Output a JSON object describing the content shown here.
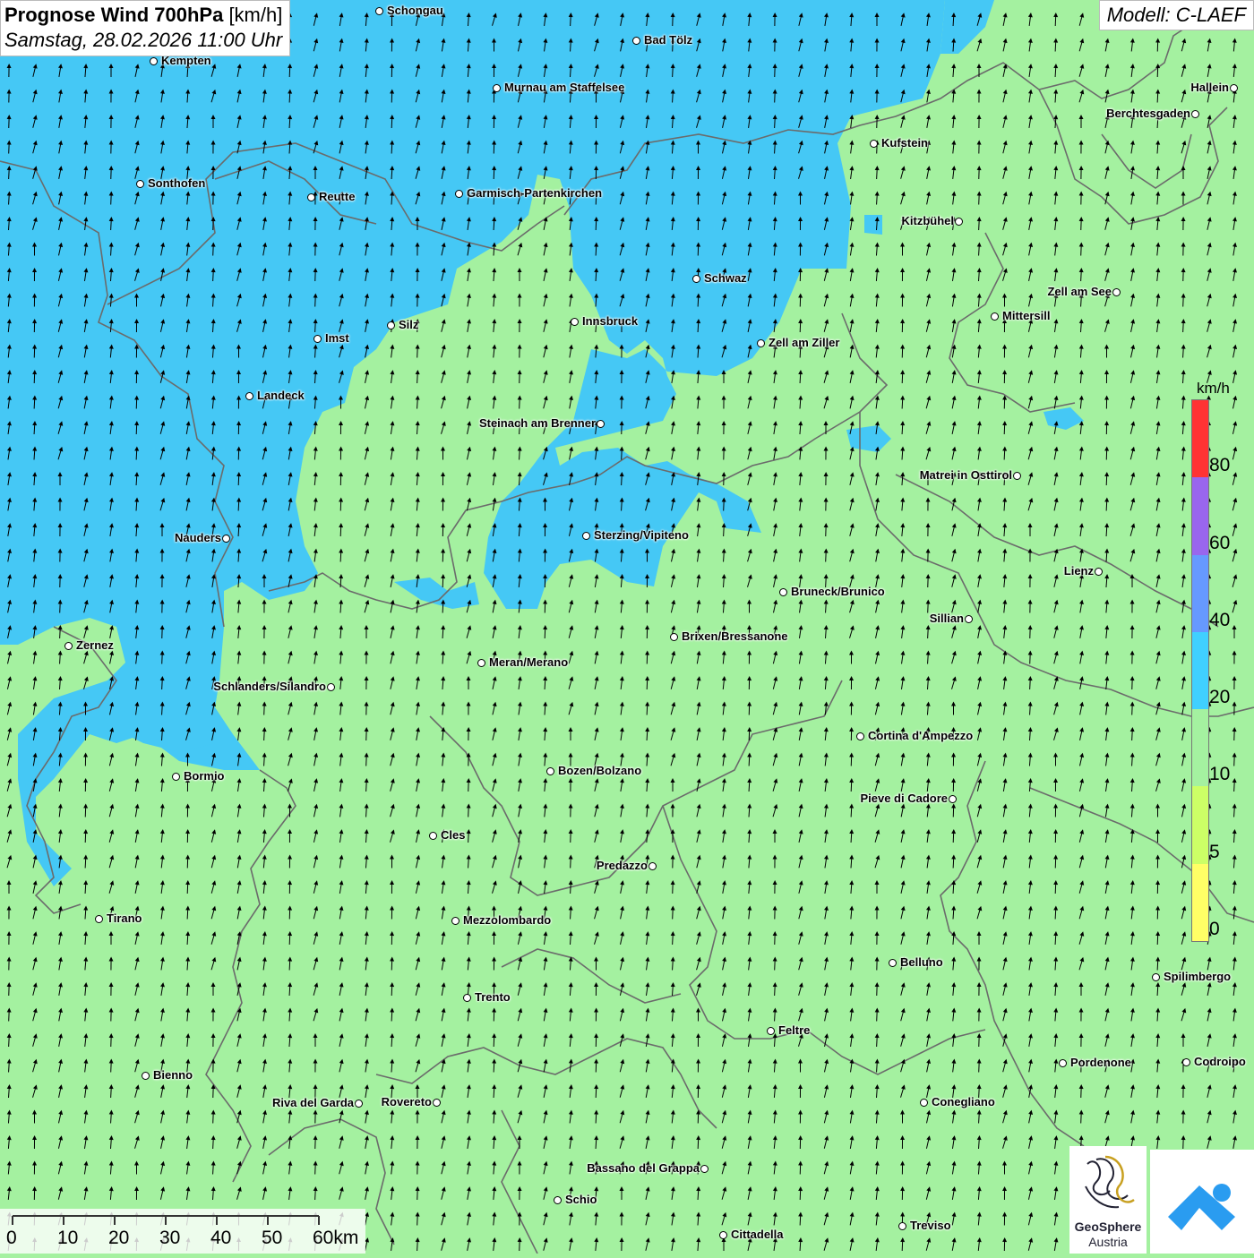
{
  "header": {
    "title_bold": "Prognose Wind 700hPa",
    "title_unit": "[km/h]",
    "datetime": "Samstag, 28.02.2026 11:00 Uhr",
    "model": "Modell: C-LAEF"
  },
  "legend": {
    "unit": "km/h",
    "labels": [
      "0",
      "5",
      "10",
      "20",
      "40",
      "60",
      "80"
    ],
    "colors": [
      "#ffff66",
      "#ccff66",
      "#a4f1a0",
      "#40d0ff",
      "#6699ff",
      "#9966ee",
      "#ff3333"
    ]
  },
  "scale_bar": {
    "labels": [
      "0",
      "10",
      "20",
      "30",
      "40",
      "50",
      "60km"
    ]
  },
  "logos": {
    "geosphere_line1": "GeoSphere",
    "geosphere_line2": "Austria"
  },
  "colors": {
    "low_wind": "#a4f1a0",
    "high_wind": "#45c8f5"
  },
  "cities": [
    {
      "name": "Schongau"
    },
    {
      "name": "Bad Tölz"
    },
    {
      "name": "Kempten"
    },
    {
      "name": "Murnau am Staffelsee"
    },
    {
      "name": "Hallein"
    },
    {
      "name": "Berchtesgaden"
    },
    {
      "name": "Kufstein"
    },
    {
      "name": "Sonthofen"
    },
    {
      "name": "Reutte"
    },
    {
      "name": "Garmisch-Partenkirchen"
    },
    {
      "name": "Kitzbühel"
    },
    {
      "name": "Schwaz"
    },
    {
      "name": "Zell am See"
    },
    {
      "name": "Mittersill"
    },
    {
      "name": "Innsbruck"
    },
    {
      "name": "Silz"
    },
    {
      "name": "Imst"
    },
    {
      "name": "Zell am Ziller"
    },
    {
      "name": "Landeck"
    },
    {
      "name": "Steinach am Brenner"
    },
    {
      "name": "Matrei in Osttirol"
    },
    {
      "name": "Nauders"
    },
    {
      "name": "Sterzing/Vipiteno"
    },
    {
      "name": "Lienz"
    },
    {
      "name": "Bruneck/Brunico"
    },
    {
      "name": "Sillian"
    },
    {
      "name": "Brixen/Bressanone"
    },
    {
      "name": "Zernez"
    },
    {
      "name": "Meran/Merano"
    },
    {
      "name": "Schlanders/Silandro"
    },
    {
      "name": "Cortina d'Ampezzo"
    },
    {
      "name": "Bozen/Bolzano"
    },
    {
      "name": "Bormio"
    },
    {
      "name": "Pieve di Cadore"
    },
    {
      "name": "Cles"
    },
    {
      "name": "Predazzo"
    },
    {
      "name": "Tirano"
    },
    {
      "name": "Mezzolombardo"
    },
    {
      "name": "Belluno"
    },
    {
      "name": "Spilimbergo"
    },
    {
      "name": "Trento"
    },
    {
      "name": "Feltre"
    },
    {
      "name": "Pordenone"
    },
    {
      "name": "Codroipo"
    },
    {
      "name": "Bienno"
    },
    {
      "name": "Riva del Garda"
    },
    {
      "name": "Rovereto"
    },
    {
      "name": "Conegliano"
    },
    {
      "name": "Bassano del Grappa"
    },
    {
      "name": "Schio"
    },
    {
      "name": "Treviso"
    },
    {
      "name": "Cittadella"
    }
  ]
}
